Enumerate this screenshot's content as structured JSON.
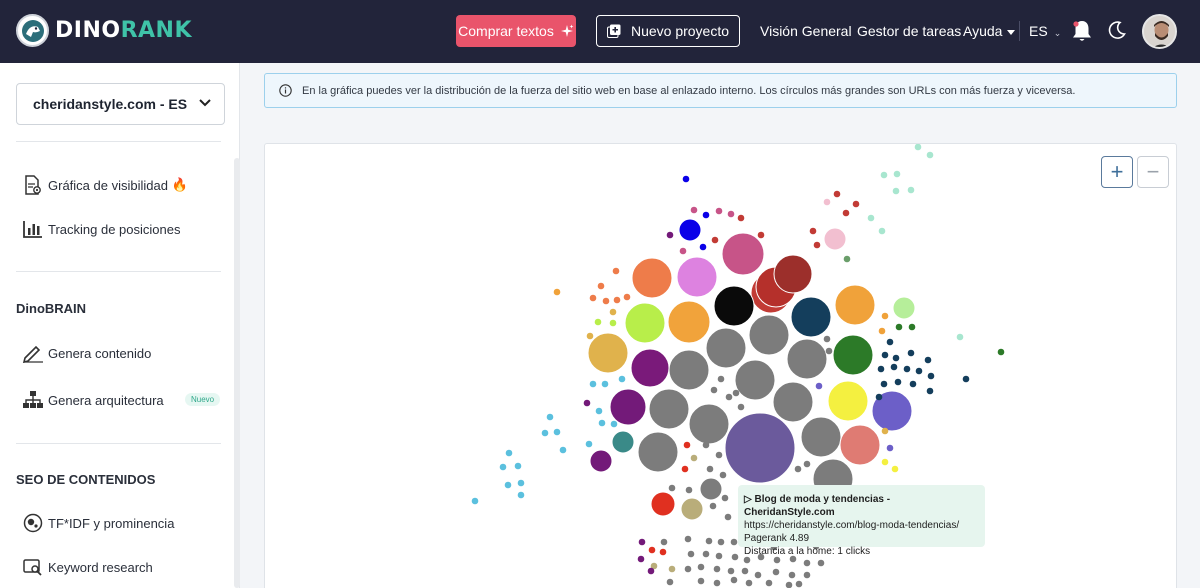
{
  "header": {
    "logo_part1": "DINO",
    "logo_part2": "RANK",
    "comprar_label": "Comprar textos",
    "nuevo_label": "Nuevo proyecto",
    "nav": [
      "Visión General",
      "Gestor de tareas",
      "Ayuda"
    ],
    "lang": "ES"
  },
  "sidebar": {
    "project": "cheridanstyle.com - ES",
    "items_top": [
      {
        "label": "Gráfica de visibilidad",
        "emoji": "🔥",
        "icon": "document-chart-icon"
      },
      {
        "label": "Tracking de posiciones",
        "icon": "bar-chart-icon"
      }
    ],
    "section1_title": "DinoBRAIN",
    "items_brain": [
      {
        "label": "Genera contenido",
        "icon": "pencil-icon"
      },
      {
        "label": "Genera arquitectura",
        "icon": "hierarchy-icon",
        "badge": "Nuevo"
      }
    ],
    "section2_title": "SEO DE CONTENIDOS",
    "items_seo": [
      {
        "label": "TF*IDF y prominencia",
        "icon": "bubbles-icon"
      },
      {
        "label": "Keyword research",
        "icon": "keyword-search-icon"
      }
    ]
  },
  "main": {
    "info_text": "En la gráfica puedes ver la distribución de la fuerza del sitio web en base al enlazado interno. Los círculos más grandes son URLs con más fuerza y viceversa.",
    "zoom_in": "+",
    "zoom_out": "−"
  },
  "tooltip": {
    "title": "▷ Blog de moda y tendencias - CheridanStyle.com",
    "url": "https://cheridanstyle.com/blog-moda-tendencias/",
    "pagerank": "Pagerank 4.89",
    "distance": "Distancia a la home: 1 clicks"
  },
  "colors": {
    "topbar": "#22243a",
    "accent_pink": "#e9546b",
    "brand_teal": "#3fc3a8"
  }
}
